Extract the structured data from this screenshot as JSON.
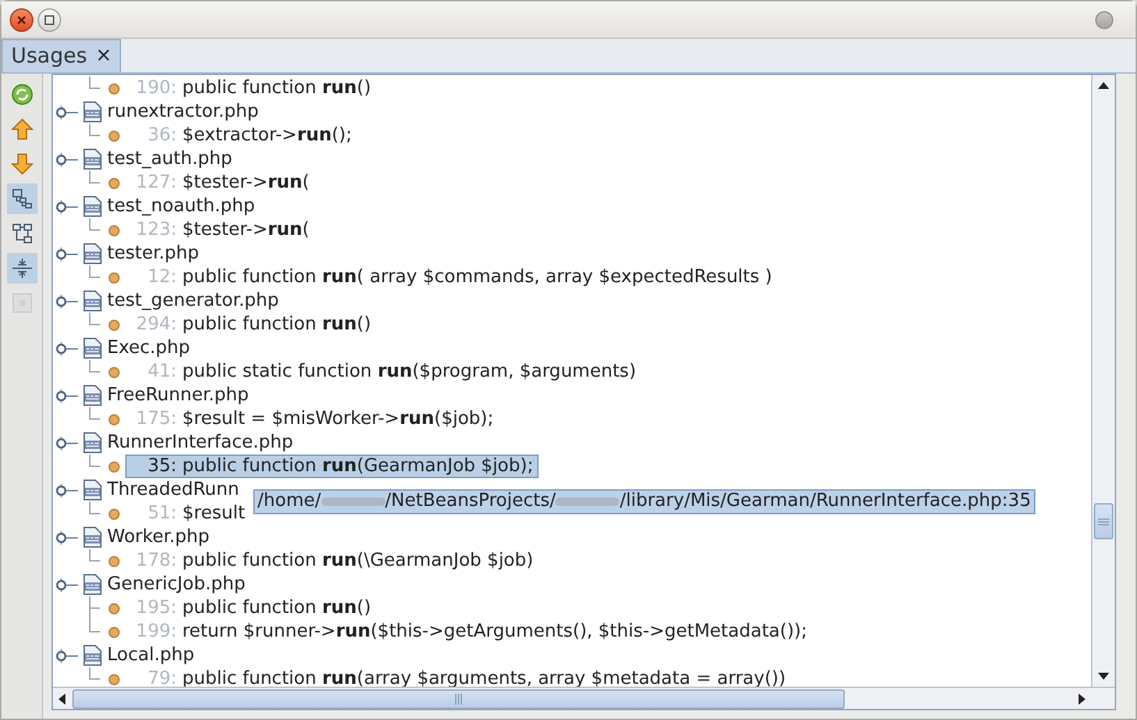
{
  "tab": {
    "label": "Usages",
    "close": "×",
    "selected": true
  },
  "toolbar": [
    {
      "kind": "refresh",
      "selected": false,
      "disabled": false
    },
    {
      "kind": "up",
      "selected": false,
      "disabled": false
    },
    {
      "kind": "down",
      "selected": false,
      "disabled": false
    },
    {
      "kind": "group",
      "selected": true,
      "disabled": false
    },
    {
      "kind": "tree",
      "selected": false,
      "disabled": false
    },
    {
      "kind": "expand",
      "selected": true,
      "disabled": false
    },
    {
      "kind": "stop",
      "selected": false,
      "disabled": true
    }
  ],
  "tree": [
    {
      "kind": "match",
      "line": "190:",
      "code": "public function **run**()",
      "selected": false
    },
    {
      "kind": "file",
      "name": "runextractor.php",
      "children": [
        {
          "line": "36:",
          "code": "$extractor->**run**();",
          "selected": false
        }
      ]
    },
    {
      "kind": "file",
      "name": "test_auth.php",
      "children": [
        {
          "line": "127:",
          "code": "$tester->**run**(",
          "selected": false
        }
      ]
    },
    {
      "kind": "file",
      "name": "test_noauth.php",
      "children": [
        {
          "line": "123:",
          "code": "$tester->**run**(",
          "selected": false
        }
      ]
    },
    {
      "kind": "file",
      "name": "tester.php",
      "children": [
        {
          "line": "12:",
          "code": "public function **run**( array $commands, array $expectedResults )",
          "selected": false
        }
      ]
    },
    {
      "kind": "file",
      "name": "test_generator.php",
      "children": [
        {
          "line": "294:",
          "code": "public function **run**()",
          "selected": false
        }
      ]
    },
    {
      "kind": "file",
      "name": "Exec.php",
      "children": [
        {
          "line": "41:",
          "code": "public static function **run**($program, $arguments)",
          "selected": false
        }
      ]
    },
    {
      "kind": "file",
      "name": "FreeRunner.php",
      "children": [
        {
          "line": "175:",
          "code": "$result = $misWorker->**run**($job);",
          "selected": false
        }
      ]
    },
    {
      "kind": "file",
      "name": "RunnerInterface.php",
      "children": [
        {
          "line": "35:",
          "code": "public function **run**(GearmanJob $job);",
          "selected": true
        }
      ]
    },
    {
      "kind": "file",
      "name": "ThreadedRunn",
      "children": [
        {
          "line": "51:",
          "code": "$result",
          "selected": false
        }
      ]
    },
    {
      "kind": "file",
      "name": "Worker.php",
      "children": [
        {
          "line": "178:",
          "code": "public function **run**(\\GearmanJob $job)",
          "selected": false
        }
      ]
    },
    {
      "kind": "file",
      "name": "GenericJob.php",
      "children": [
        {
          "line": "195:",
          "code": "public function **run**()",
          "selected": false
        },
        {
          "line": "199:",
          "code": "return $runner->**run**($this->getArguments(), $this->getMetadata());",
          "selected": false
        }
      ]
    },
    {
      "kind": "file",
      "name": "Local.php",
      "children": [
        {
          "line": "79:",
          "code": "public function **run**(array $arguments, array $metadata = array())",
          "selected": false
        }
      ]
    }
  ],
  "tooltip": {
    "parts": [
      "/home/",
      "/NetBeansProjects/",
      "/library/Mis/Gearman/RunnerInterface.php:35"
    ]
  }
}
